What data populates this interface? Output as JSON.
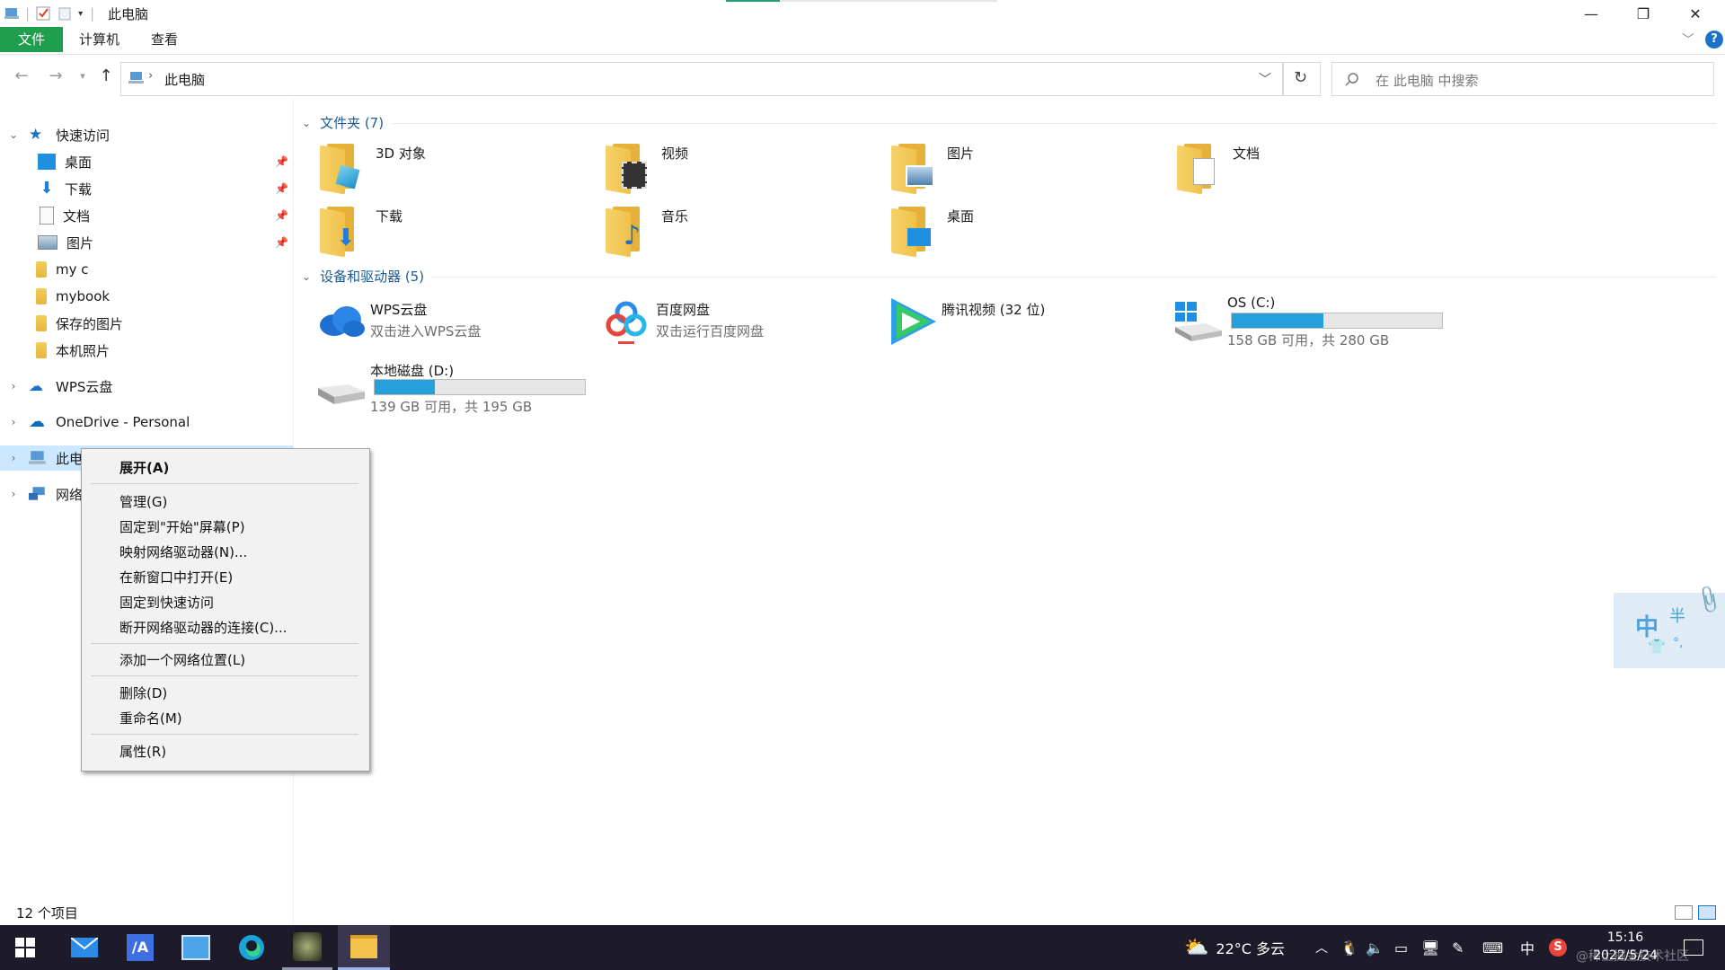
{
  "window": {
    "title": "此电脑",
    "minimize": "—",
    "restore": "❐",
    "close": "✕"
  },
  "ribbon": {
    "tabs": [
      "文件",
      "计算机",
      "查看"
    ],
    "collapse": "﹀",
    "help": "?"
  },
  "address": {
    "path": "此电脑",
    "search_placeholder": "在 此电脑 中搜索"
  },
  "sidebar": {
    "quick_access": "快速访问",
    "pinned": [
      "桌面",
      "下载",
      "文档",
      "图片"
    ],
    "folders": [
      "my c",
      "mybook",
      "保存的图片",
      "本机照片"
    ],
    "wps": "WPS云盘",
    "onedrive": "OneDrive - Personal",
    "thispc": "此电脑",
    "network": "网络"
  },
  "folders_group": {
    "header": "文件夹 (7)",
    "items": [
      "3D 对象",
      "视频",
      "图片",
      "文档",
      "下载",
      "音乐",
      "桌面"
    ]
  },
  "devices_group": {
    "header": "设备和驱动器 (5)",
    "wps": {
      "name": "WPS云盘",
      "sub": "双击进入WPS云盘"
    },
    "baidu": {
      "name": "百度网盘",
      "sub": "双击运行百度网盘"
    },
    "tencent": {
      "name": "腾讯视频 (32 位)"
    },
    "c_drive": {
      "name": "OS (C:)",
      "sub": "158 GB 可用，共 280 GB",
      "used_fraction": 0.436
    },
    "d_drive": {
      "name": "本地磁盘 (D:)",
      "sub": "139 GB 可用，共 195 GB",
      "used_fraction": 0.287
    }
  },
  "context_menu": {
    "expand": "展开(A)",
    "manage": "管理(G)",
    "pin_start": "固定到\"开始\"屏幕(P)",
    "map_drive": "映射网络驱动器(N)...",
    "new_window": "在新窗口中打开(E)",
    "pin_quick": "固定到快速访问",
    "disconnect": "断开网络驱动器的连接(C)...",
    "add_location": "添加一个网络位置(L)",
    "delete": "删除(D)",
    "rename": "重命名(M)",
    "properties": "属性(R)"
  },
  "status": {
    "count": "12 个项目"
  },
  "ime": {
    "mode": "中",
    "half": "半",
    "punct": "°,"
  },
  "taskbar": {
    "weather": "22°C 多云",
    "lang": "中",
    "time": "15:16",
    "date": "2022/5/24",
    "watermark": "@稀土掘金技术社区"
  }
}
